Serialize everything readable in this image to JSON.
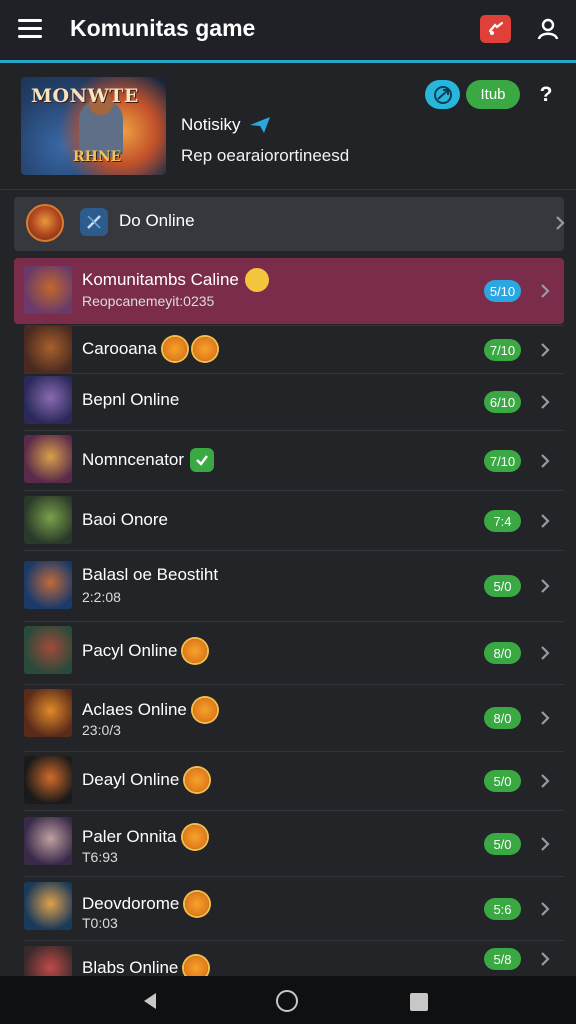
{
  "header": {
    "title": "Komunitas game",
    "menu_icon": "hamburger-menu-icon",
    "gamepad_icon": "gamepad-icon",
    "profile_icon": "user-icon",
    "accent_color": "#2aa7c8"
  },
  "hero": {
    "art_text_top": "MONWTE",
    "art_text_bottom": "RHNE",
    "title": "Notisiky",
    "subtitle": "Rep oearaiorortineesd",
    "share_icon": "share-icon",
    "pill_label": "Itub",
    "help_label": "?"
  },
  "online_bar": {
    "label": "Do Online",
    "avatar_icon": "avatar-icon",
    "cube_icon": "cube-icon"
  },
  "rows": [
    {
      "name": "Komunitambs Caline",
      "sub": "Reopcanemeyit:0235",
      "score": "5/10",
      "badge": "smile"
    },
    {
      "name": "Carooana",
      "sub": "",
      "score": "7/10",
      "badge": "sun2"
    },
    {
      "name": "Bepnl Online",
      "sub": "",
      "score": "6/10",
      "badge": ""
    },
    {
      "name": "Nomncenator",
      "sub": "",
      "score": "7/10",
      "badge": "check"
    },
    {
      "name": "Baoi Onore",
      "sub": "",
      "score": "7:4",
      "badge": ""
    },
    {
      "name": "Balasl oe Beostiht",
      "sub": "2:2:08",
      "score": "5/0",
      "badge": ""
    },
    {
      "name": "Pacyl Online",
      "sub": "",
      "score": "8/0",
      "badge": "sun"
    },
    {
      "name": "Aclaes Online",
      "sub": "23:0/3",
      "score": "8/0",
      "badge": "sun"
    },
    {
      "name": "Deayl Online",
      "sub": "",
      "score": "5/0",
      "badge": "sun"
    },
    {
      "name": "Paler Onnita",
      "sub": "T6:93",
      "score": "5/0",
      "badge": "sun-green"
    },
    {
      "name": "Deovdorome",
      "sub": "T0:03",
      "score": "5:6",
      "badge": "sun"
    },
    {
      "name": "Blabs Online",
      "sub": "",
      "score": "5/8",
      "badge": "sun"
    }
  ],
  "navbar": {
    "back_icon": "back-triangle-icon",
    "home_icon": "home-circle-icon",
    "recent_icon": "recent-square-icon"
  }
}
